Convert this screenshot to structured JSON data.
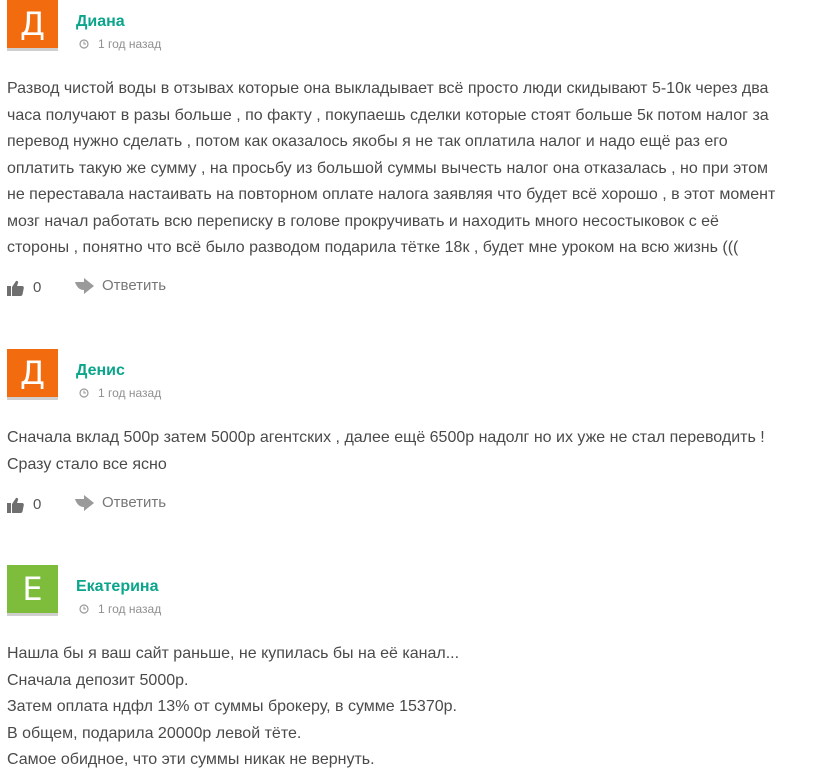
{
  "colors": {
    "accent": "#0aa58b",
    "avatar_orange": "#f26b0f",
    "avatar_green": "#7dbd3b"
  },
  "comments": [
    {
      "avatar_letter": "Д",
      "avatar_color": "#f26b0f",
      "author": "Диана",
      "time": "1 год назад",
      "text": "Развод чистой воды в отзывах которые она выкладывает всё просто люди скидывают 5-10к через два\nчаса получают в разы больше , по факту , покупаешь сделки которые стоят больше 5к потом налог за\nперевод нужно сделать , потом как оказалось якобы я не так оплатила налог и надо ещё раз его\nоплатить такую же сумму , на просьбу из большой суммы вычесть налог она отказалась , но при этом\nне переставала настаивать на повторном оплате налога заявляя что будет всё хорошо , в этот момент\nмозг начал работать всю переписку в голове прокручивать и находить много несостыковок с её\nстороны , понятно что всё было разводом подарила тётке 18к , будет мне уроком на всю жизнь (((",
      "likes": "0",
      "reply_label": "Ответить"
    },
    {
      "avatar_letter": "Д",
      "avatar_color": "#f26b0f",
      "author": "Денис",
      "time": "1 год назад",
      "text": "Сначала вклад 500р затем 5000р агентских , далее ещё 6500р надолг но их уже не стал переводить !\nСразу стало все ясно",
      "likes": "0",
      "reply_label": "Ответить"
    },
    {
      "avatar_letter": "Е",
      "avatar_color": "#7dbd3b",
      "author": "Екатерина",
      "time": "1 год назад",
      "text": "Нашла бы я ваш сайт раньше, не купилась бы на её канал...\nСначала депозит 5000р.\nЗатем оплата ндфл 13% от суммы брокеру, в сумме 15370р.\nВ общем, подарила 20000р левой тёте.\nСамое обидное, что эти суммы никак не вернуть."
    }
  ]
}
